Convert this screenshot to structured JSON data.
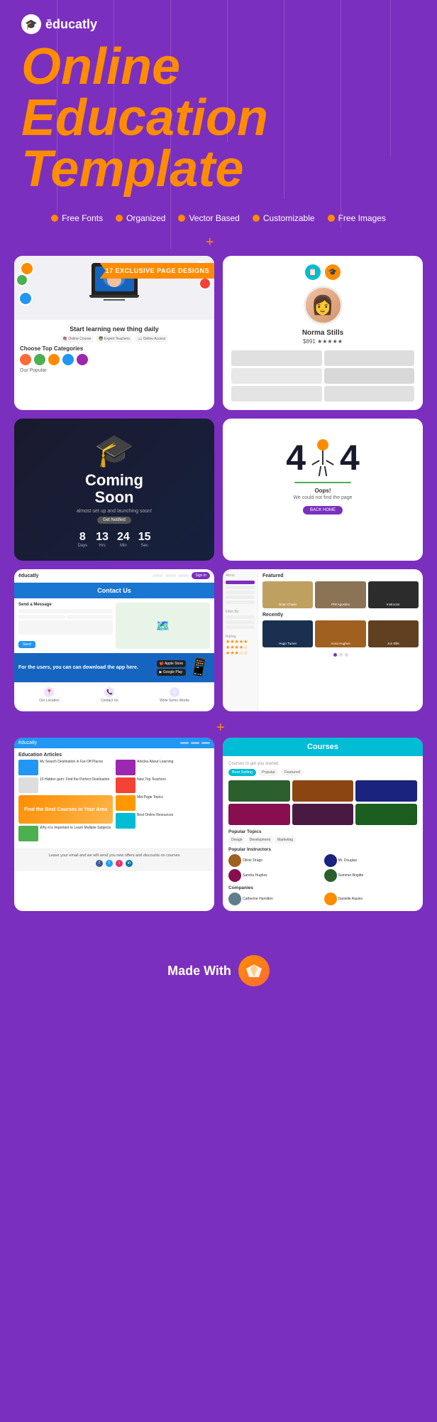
{
  "logo": {
    "icon": "🎓",
    "text": "ēducatly"
  },
  "hero": {
    "title_line1": "Online",
    "title_line2": "Education",
    "title_line3": "Template"
  },
  "features": [
    "Free Fonts",
    "Organized",
    "Vector Based",
    "Customizable",
    "Free Images"
  ],
  "exclusive_banner": "17 EXCLUSIVE PAGE DESIGNS",
  "hero_preview": {
    "tagline": "Start learning new thing daily",
    "categories_title": "Choose Top Categories",
    "popular_text": "Our Popular"
  },
  "coming_soon": {
    "title_line1": "Coming",
    "title_line2": "Soon",
    "days": "8",
    "hours": "13",
    "minutes": "24",
    "seconds": "15",
    "days_label": "Days",
    "hours_label": "Hrs",
    "minutes_label": "Min",
    "seconds_label": "Sec"
  },
  "contact": {
    "brand": "ēducatly",
    "title": "Contact Us",
    "section_title": "Send a Message",
    "app_text": "For the users, you can can download the app here.",
    "app_store": "Apple Store",
    "play_store": "Google Play"
  },
  "error_page": {
    "code": "4",
    "code2": "4",
    "message": "Oops!",
    "sub_message": "We could not find the page",
    "btn": "BACK HOME"
  },
  "courses": {
    "header": "Courses",
    "tabs": [
      "Best Selling",
      "Popular",
      "Featured"
    ]
  },
  "bottom": {
    "made_with": "Made With",
    "icon": "💎"
  },
  "instructor_sections": {
    "featured_label": "Featured",
    "recently_label": "Recently",
    "rating_label": "Rating"
  },
  "blog_section": {
    "education_label": "Education Articles",
    "footer_text": "Leave your email and we will send you new offers and discounts on courses"
  }
}
